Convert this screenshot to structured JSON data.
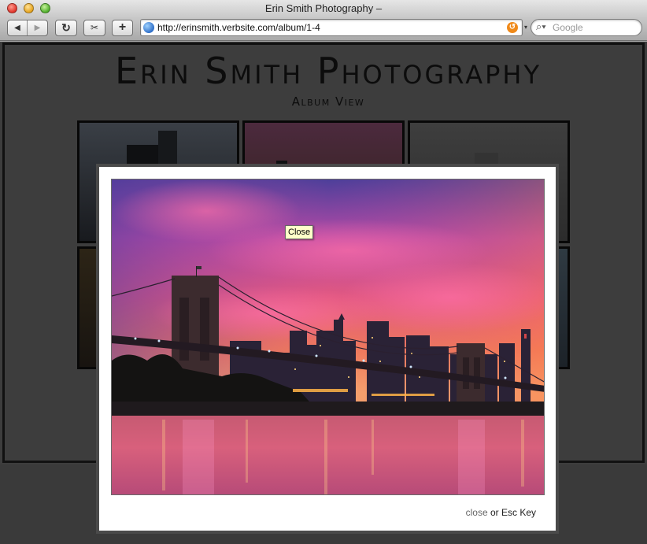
{
  "window": {
    "title": "Erin Smith Photography –"
  },
  "toolbar": {
    "back_glyph": "◀",
    "forward_glyph": "▶",
    "reload_glyph": "↻",
    "snip_glyph": "✂",
    "add_glyph": "+",
    "url": "http://erinsmith.verbsite.com/album/1-4",
    "rss_glyph": "↺",
    "search_placeholder": "Google",
    "search_glyph": "⌕▾"
  },
  "site": {
    "title": "Erin Smith Photography",
    "subtitle": "Album View"
  },
  "lightbox": {
    "tooltip": "Close",
    "close_link": "close",
    "footer_rest": " or Esc Key"
  },
  "icons": [
    "back-icon",
    "forward-icon",
    "reload-icon",
    "snip-icon",
    "add-bookmark-icon",
    "globe-icon",
    "rss-icon",
    "search-icon"
  ]
}
